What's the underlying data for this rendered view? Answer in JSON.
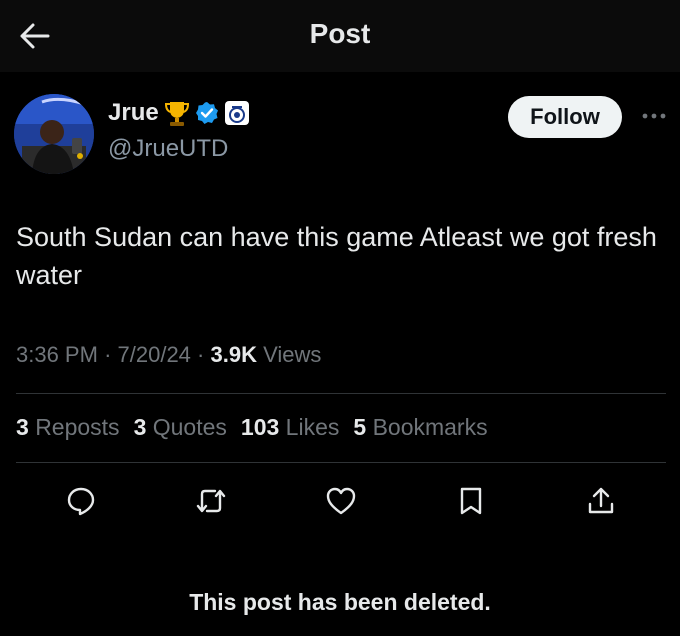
{
  "header": {
    "title": "Post"
  },
  "author": {
    "display_name": "Jrue",
    "handle": "@JrueUTD"
  },
  "follow_label": "Follow",
  "post": {
    "text": "South Sudan can have this game Atleast we got fresh water",
    "time": "3:36 PM",
    "date": "7/20/24",
    "views_count": "3.9K",
    "views_label": "Views"
  },
  "stats": {
    "reposts_count": "3",
    "reposts_label": "Reposts",
    "quotes_count": "3",
    "quotes_label": "Quotes",
    "likes_count": "103",
    "likes_label": "Likes",
    "bookmarks_count": "5",
    "bookmarks_label": "Bookmarks"
  },
  "actions": [
    "reply-icon",
    "repost-icon",
    "like-icon",
    "bookmark-icon",
    "share-icon"
  ],
  "deleted_notice": "This post has been deleted.",
  "colors": {
    "background": "#000000",
    "text": "#e7e9ea",
    "secondary": "#71767b",
    "verified": "#1d9bf0",
    "trophy": "#f5b400"
  }
}
